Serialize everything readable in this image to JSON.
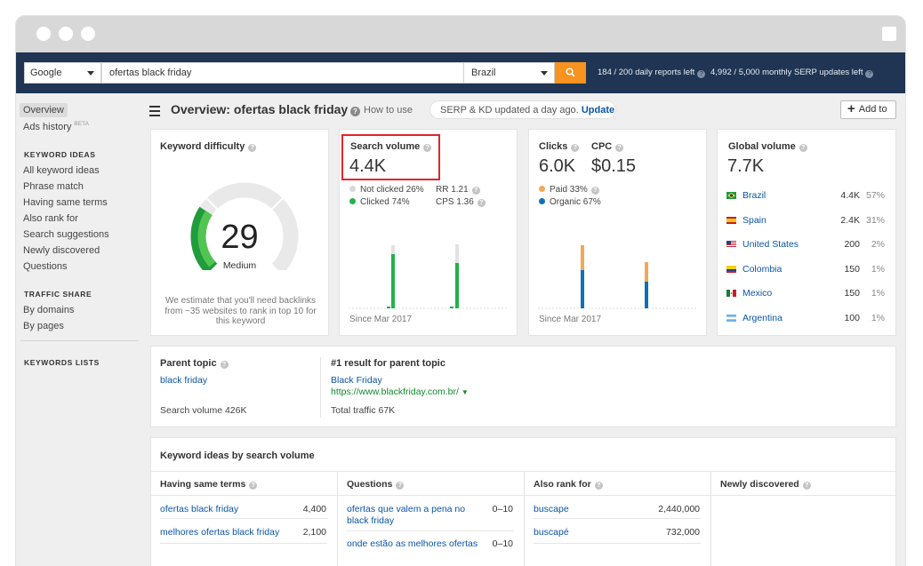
{
  "search": {
    "engine": "Google",
    "query": "ofertas black friday",
    "country": "Brazil",
    "daily_reports": "184 / 200 daily reports left",
    "serp_updates": "4,992 / 5,000 monthly SERP updates left"
  },
  "sidebar": {
    "overview": "Overview",
    "ads_history": "Ads history",
    "beta": "BETA",
    "keyword_ideas_head": "KEYWORD IDEAS",
    "keyword_items": [
      "All keyword ideas",
      "Phrase match",
      "Having same terms",
      "Also rank for",
      "Search suggestions",
      "Newly discovered",
      "Questions"
    ],
    "traffic_share_head": "TRAFFIC SHARE",
    "traffic_items": [
      "By domains",
      "By pages"
    ],
    "keywords_lists_head": "KEYWORDS LISTS"
  },
  "header": {
    "title": "Overview: ofertas black friday",
    "how_to_use": "How to use",
    "updated_text": "SERP & KD updated a day ago.",
    "update_link": "Update",
    "add_to": "Add to"
  },
  "difficulty": {
    "title": "Keyword difficulty",
    "score": "29",
    "level": "Medium",
    "level_fraction": 0.29,
    "note": "We estimate that you'll need backlinks from ~35 websites to rank in top 10 for this keyword"
  },
  "volume": {
    "title": "Search volume",
    "value": "4.4K",
    "not_clicked": "Not clicked 26%",
    "clicked": "Clicked 74%",
    "rr": "RR 1.21",
    "cps": "CPS 1.36",
    "since": "Since Mar 2017",
    "colors": {
      "clicked": "#21b24b",
      "not_clicked": "#d9d9d9"
    }
  },
  "clicks": {
    "title": "Clicks",
    "value": "6.0K",
    "cpc_title": "CPC",
    "cpc_value": "$0.15",
    "paid": "Paid 33%",
    "organic": "Organic 67%",
    "since": "Since Mar 2017",
    "colors": {
      "paid": "#f4a759",
      "organic": "#1170b5"
    }
  },
  "global": {
    "title": "Global volume",
    "value": "7.7K",
    "countries": [
      {
        "name": "Brazil",
        "value": "4.4K",
        "pct": "57%"
      },
      {
        "name": "Spain",
        "value": "2.4K",
        "pct": "31%"
      },
      {
        "name": "United States",
        "value": "200",
        "pct": "2%"
      },
      {
        "name": "Colombia",
        "value": "150",
        "pct": "1%"
      },
      {
        "name": "Mexico",
        "value": "150",
        "pct": "1%"
      },
      {
        "name": "Argentina",
        "value": "100",
        "pct": "1%"
      }
    ]
  },
  "parent": {
    "title": "Parent topic",
    "topic": "black friday",
    "volume": "Search volume 426K",
    "first_title": "#1 result for parent topic",
    "first_name": "Black Friday",
    "first_url": "https://www.blackfriday.com.br/",
    "total_traffic": "Total traffic 67K"
  },
  "ideas": {
    "title": "Keyword ideas by search volume",
    "cols": [
      {
        "head": "Having same terms",
        "rows": [
          {
            "kw": "ofertas black friday",
            "v": "4,400"
          },
          {
            "kw": "melhores ofertas black friday",
            "v": "2,100"
          }
        ]
      },
      {
        "head": "Questions",
        "rows": [
          {
            "kw": "ofertas que valem a pena no black friday",
            "v": "0–10"
          },
          {
            "kw": "onde estão as melhores ofertas",
            "v": "0–10"
          }
        ]
      },
      {
        "head": "Also rank for",
        "rows": [
          {
            "kw": "buscape",
            "v": "2,440,000"
          },
          {
            "kw": "buscapé",
            "v": "732,000"
          }
        ]
      },
      {
        "head": "Newly discovered",
        "rows": []
      }
    ]
  }
}
